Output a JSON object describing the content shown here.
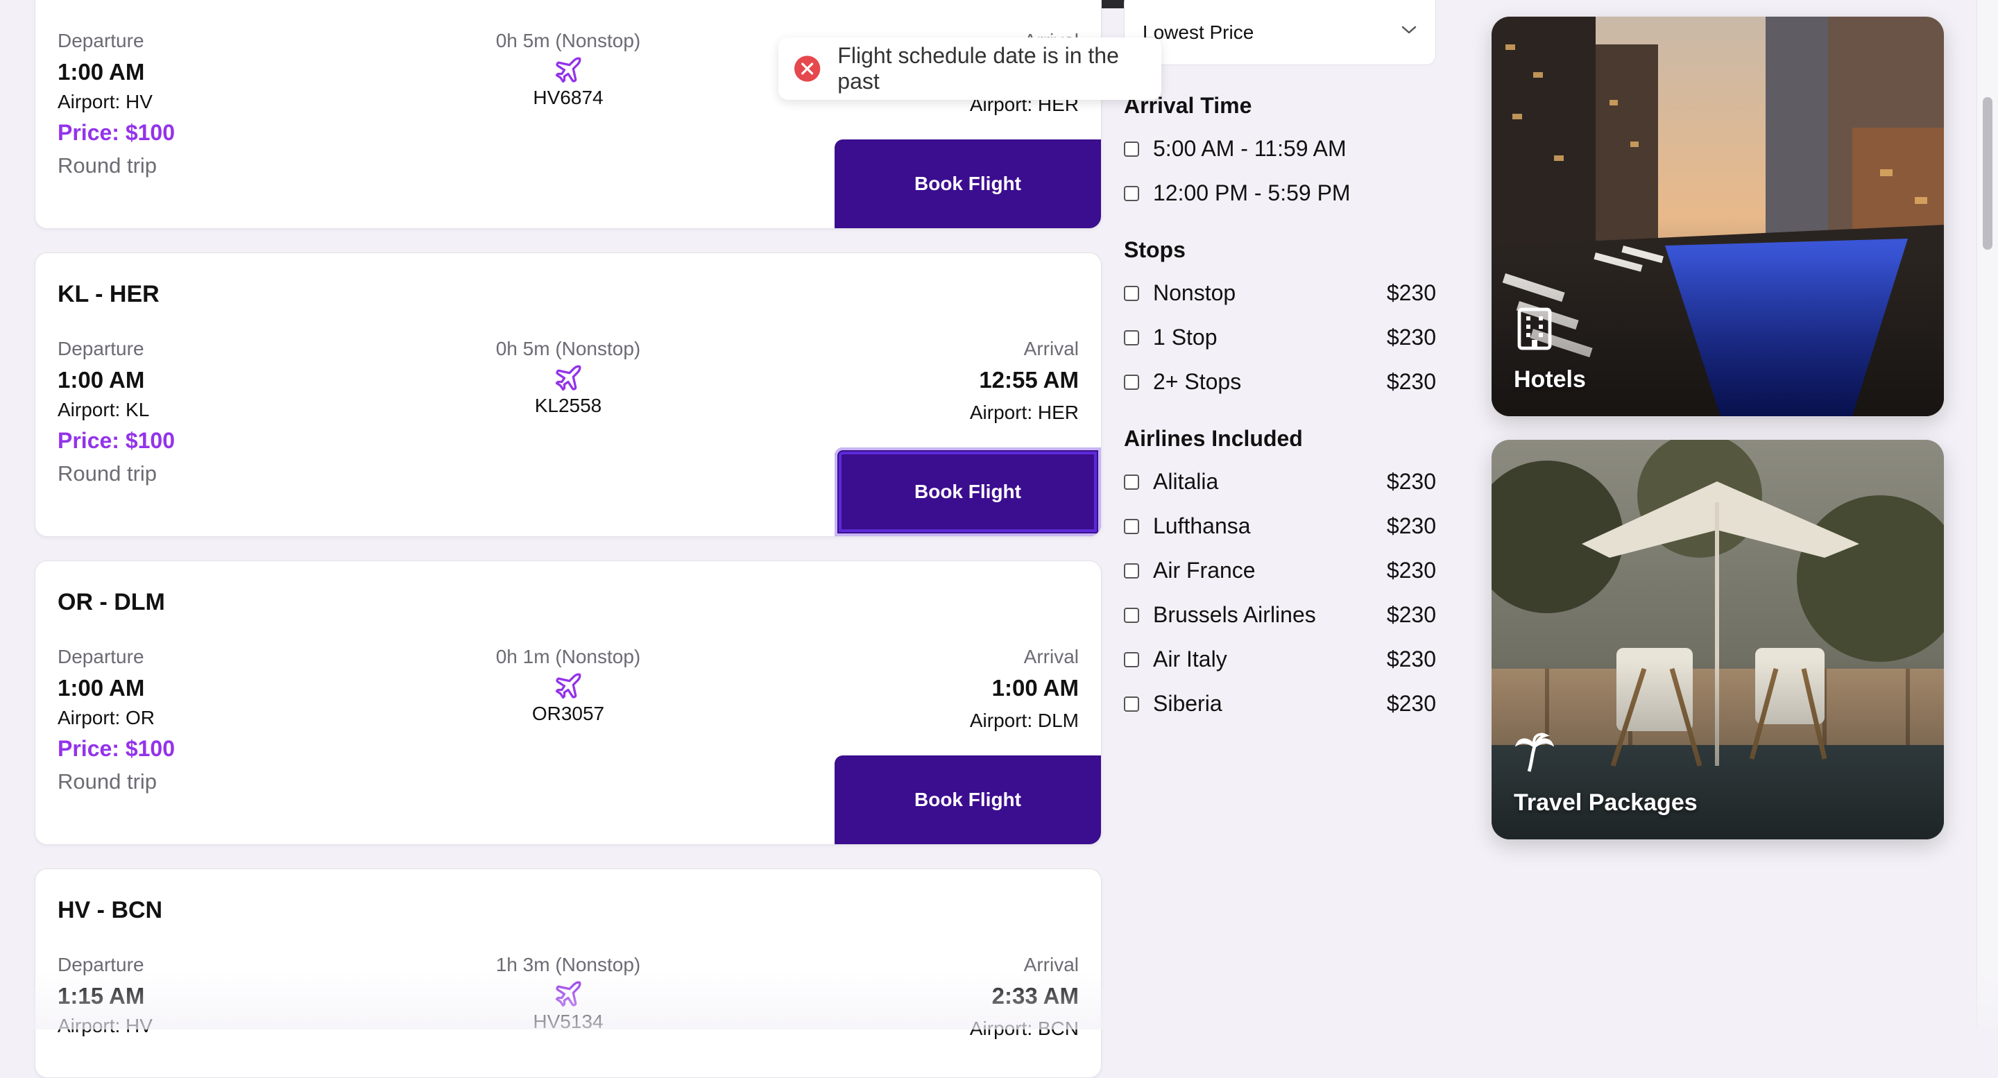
{
  "toast": {
    "message": "Flight schedule date is in the past",
    "icon": "error-x-icon"
  },
  "flights": [
    {
      "route": "",
      "departure_label": "Departure",
      "departure_time": "1:00 AM",
      "departure_airport": "Airport: HV",
      "duration": "0h 5m (Nonstop)",
      "flight_code": "HV6874",
      "arrival_label": "Arrival",
      "arrival_time": "",
      "arrival_airport": "Airport: HER",
      "price": "Price: $100",
      "trip_type": "Round trip",
      "book_label": "Book Flight"
    },
    {
      "route": "KL - HER",
      "departure_label": "Departure",
      "departure_time": "1:00 AM",
      "departure_airport": "Airport: KL",
      "duration": "0h 5m (Nonstop)",
      "flight_code": "KL2558",
      "arrival_label": "Arrival",
      "arrival_time": "12:55 AM",
      "arrival_airport": "Airport: HER",
      "price": "Price: $100",
      "trip_type": "Round trip",
      "book_label": "Book Flight"
    },
    {
      "route": "OR - DLM",
      "departure_label": "Departure",
      "departure_time": "1:00 AM",
      "departure_airport": "Airport: OR",
      "duration": "0h 1m (Nonstop)",
      "flight_code": "OR3057",
      "arrival_label": "Arrival",
      "arrival_time": "1:00 AM",
      "arrival_airport": "Airport: DLM",
      "price": "Price: $100",
      "trip_type": "Round trip",
      "book_label": "Book Flight"
    },
    {
      "route": "HV - BCN",
      "departure_label": "Departure",
      "departure_time": "1:15 AM",
      "departure_airport": "Airport: HV",
      "duration": "1h 3m (Nonstop)",
      "flight_code": "HV5134",
      "arrival_label": "Arrival",
      "arrival_time": "2:33 AM",
      "arrival_airport": "Airport: BCN",
      "price": "",
      "trip_type": "",
      "book_label": ""
    }
  ],
  "filters": {
    "sort_value": "Lowest Price",
    "arrival_time": {
      "title": "Arrival Time",
      "options": [
        "5:00 AM - 11:59 AM",
        "12:00 PM - 5:59 PM"
      ]
    },
    "stops": {
      "title": "Stops",
      "options": [
        {
          "name": "Nonstop",
          "price": "$230"
        },
        {
          "name": "1 Stop",
          "price": "$230"
        },
        {
          "name": "2+ Stops",
          "price": "$230"
        }
      ]
    },
    "airlines": {
      "title": "Airlines Included",
      "options": [
        {
          "name": "Alitalia",
          "price": "$230"
        },
        {
          "name": "Lufthansa",
          "price": "$230"
        },
        {
          "name": "Air France",
          "price": "$230"
        },
        {
          "name": "Brussels Airlines",
          "price": "$230"
        },
        {
          "name": "Air Italy",
          "price": "$230"
        },
        {
          "name": "Siberia",
          "price": "$230"
        }
      ]
    }
  },
  "promos": [
    {
      "title": "Hotels",
      "icon": "hotel-building-icon"
    },
    {
      "title": "Travel Packages",
      "icon": "palm-tree-icon"
    }
  ],
  "colors": {
    "accent_purple": "#9333ea",
    "button_purple": "#3b0d8f",
    "background": "#f3f1f7"
  }
}
